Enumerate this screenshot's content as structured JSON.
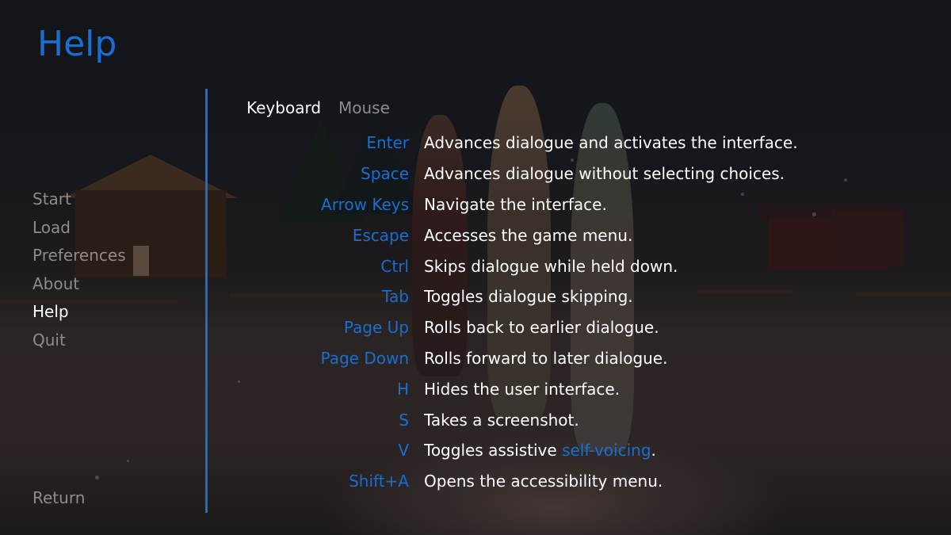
{
  "screen": {
    "title": "Help"
  },
  "nav": {
    "items": [
      {
        "label": "Start",
        "active": false
      },
      {
        "label": "Load",
        "active": false
      },
      {
        "label": "Preferences",
        "active": false
      },
      {
        "label": "About",
        "active": false
      },
      {
        "label": "Help",
        "active": true
      },
      {
        "label": "Quit",
        "active": false
      }
    ],
    "return_label": "Return"
  },
  "tabs": [
    {
      "label": "Keyboard",
      "active": true
    },
    {
      "label": "Mouse",
      "active": false
    }
  ],
  "keyboard_help": [
    {
      "key": "Enter",
      "description": "Advances dialogue and activates the interface."
    },
    {
      "key": "Space",
      "description": "Advances dialogue without selecting choices."
    },
    {
      "key": "Arrow Keys",
      "description": "Navigate the interface."
    },
    {
      "key": "Escape",
      "description": "Accesses the game menu."
    },
    {
      "key": "Ctrl",
      "description": "Skips dialogue while held down."
    },
    {
      "key": "Tab",
      "description": "Toggles dialogue skipping."
    },
    {
      "key": "Page Up",
      "description": "Rolls back to earlier dialogue."
    },
    {
      "key": "Page Down",
      "description": "Rolls forward to later dialogue."
    },
    {
      "key": "H",
      "description": "Hides the user interface."
    },
    {
      "key": "S",
      "description": "Takes a screenshot."
    },
    {
      "key": "V",
      "description_prefix": "Toggles assistive ",
      "link": "self-voicing",
      "description_suffix": "."
    },
    {
      "key": "Shift+A",
      "description": "Opens the accessibility menu."
    }
  ],
  "colors": {
    "accent": "#1a6ed1",
    "text_active": "#ffffff",
    "text_idle": "#8f8b89"
  }
}
